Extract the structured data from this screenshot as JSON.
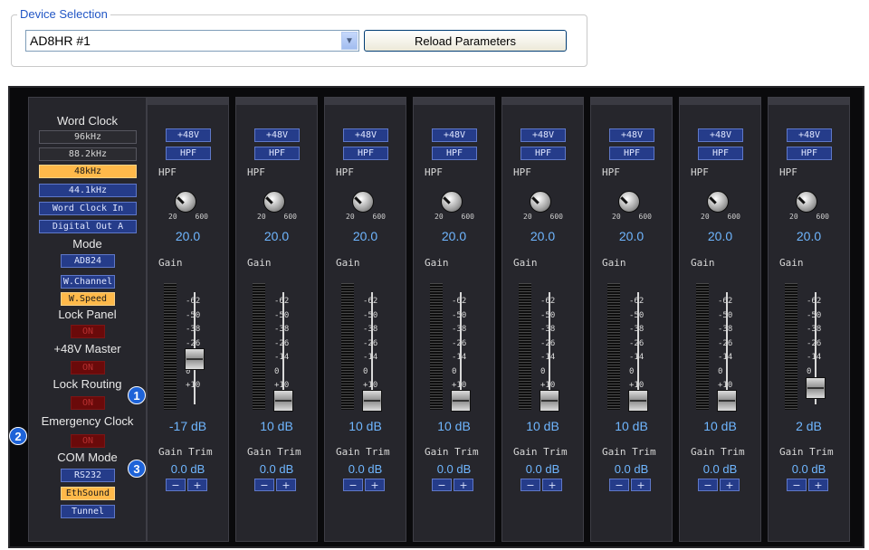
{
  "device_selection": {
    "title": "Device Selection",
    "selected": "AD8HR #1",
    "reload_label": "Reload Parameters"
  },
  "left_panel": {
    "word_clock_label": "Word Clock",
    "word_clock_options": [
      "96kHz",
      "88.2kHz",
      "48kHz",
      "44.1kHz",
      "Word Clock In",
      "Digital Out A"
    ],
    "word_clock_selected": "48kHz",
    "mode_label": "Mode",
    "mode_options": [
      "AD824",
      "W.Channel",
      "W.Speed"
    ],
    "mode_selected": "W.Speed",
    "lock_panel_label": "Lock Panel",
    "master48_label": "+48V Master",
    "lock_routing_label": "Lock Routing",
    "emergency_clock_label": "Emergency Clock",
    "com_mode_label": "COM Mode",
    "com_mode_options": [
      "RS232",
      "EthSound",
      "Tunnel"
    ],
    "com_mode_selected": "EthSound",
    "toggle_state": "ON",
    "badges": [
      "1",
      "2",
      "3"
    ]
  },
  "channel_common": {
    "phantom_label": "+48V",
    "hpf_button_label": "HPF",
    "hpf_label": "HPF",
    "knob_min": "20",
    "knob_max": "600",
    "gain_label": "Gain",
    "scale_ticks": [
      "-62",
      "-50",
      "-38",
      "-26",
      "-14",
      "0",
      "+10"
    ],
    "trim_label": "Gain Trim",
    "minus_label": "−",
    "plus_label": "+"
  },
  "channels": [
    {
      "hpf_value": "20.0",
      "gain": "-17 dB",
      "gain_db": -17,
      "trim": "0.0 dB"
    },
    {
      "hpf_value": "20.0",
      "gain": "10 dB",
      "gain_db": 10,
      "trim": "0.0 dB"
    },
    {
      "hpf_value": "20.0",
      "gain": "10 dB",
      "gain_db": 10,
      "trim": "0.0 dB"
    },
    {
      "hpf_value": "20.0",
      "gain": "10 dB",
      "gain_db": 10,
      "trim": "0.0 dB"
    },
    {
      "hpf_value": "20.0",
      "gain": "10 dB",
      "gain_db": 10,
      "trim": "0.0 dB"
    },
    {
      "hpf_value": "20.0",
      "gain": "10 dB",
      "gain_db": 10,
      "trim": "0.0 dB"
    },
    {
      "hpf_value": "20.0",
      "gain": "10 dB",
      "gain_db": 10,
      "trim": "0.0 dB"
    },
    {
      "hpf_value": "20.0",
      "gain": "2 dB",
      "gain_db": 2,
      "trim": "0.0 dB"
    }
  ]
}
